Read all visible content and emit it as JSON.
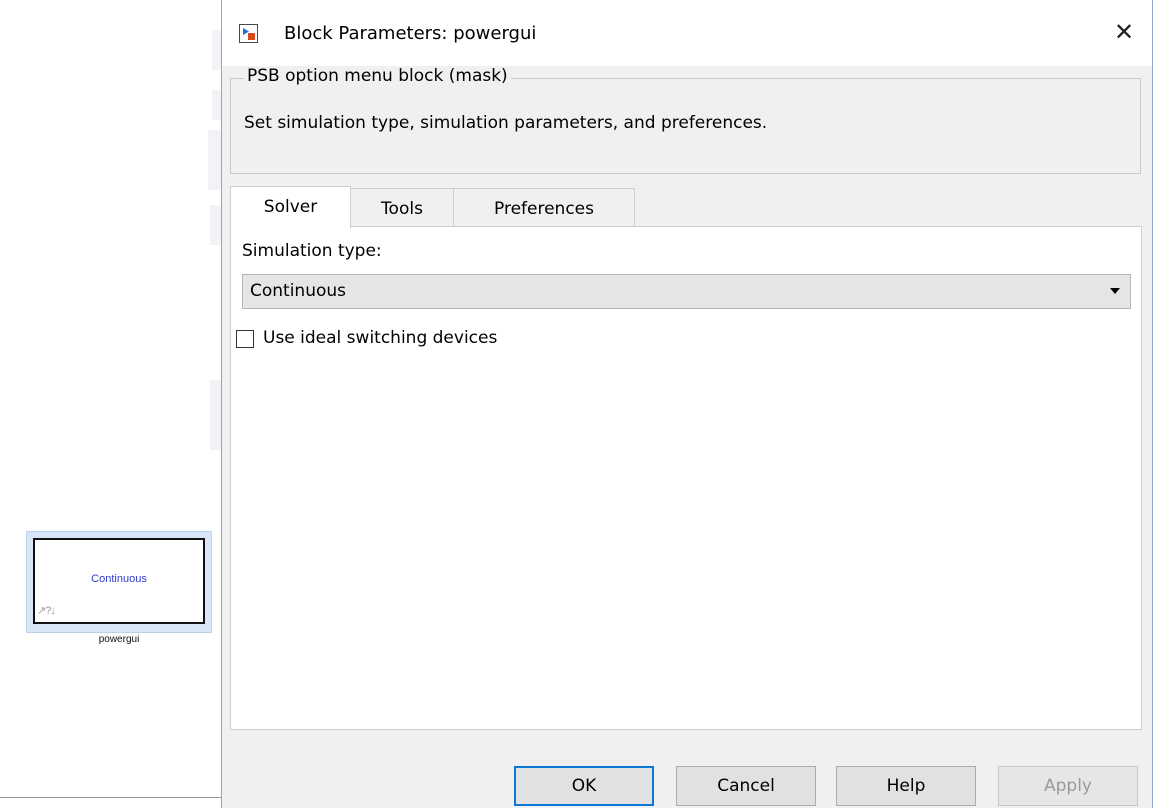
{
  "canvas": {
    "block": {
      "display_text": "Continuous",
      "caption": "powergui",
      "status_icons": "↗?↓"
    }
  },
  "dialog": {
    "title": "Block Parameters: powergui",
    "close_glyph": "✕",
    "mask": {
      "legend": "PSB option menu block (mask)",
      "description": "Set simulation type, simulation parameters, and preferences."
    },
    "tabs": [
      {
        "label": "Solver",
        "active": true
      },
      {
        "label": "Tools",
        "active": false
      },
      {
        "label": "Preferences",
        "active": false
      }
    ],
    "solver": {
      "simulation_type_label": "Simulation type:",
      "simulation_type_value": "Continuous",
      "ideal_switching_label": "Use ideal switching devices",
      "ideal_switching_checked": false
    },
    "buttons": {
      "ok": "OK",
      "cancel": "Cancel",
      "help": "Help",
      "apply": "Apply"
    }
  },
  "colors": {
    "accent": "#0a78d7",
    "block_text": "#2f3bd0",
    "selection": "#d8e6f7"
  }
}
